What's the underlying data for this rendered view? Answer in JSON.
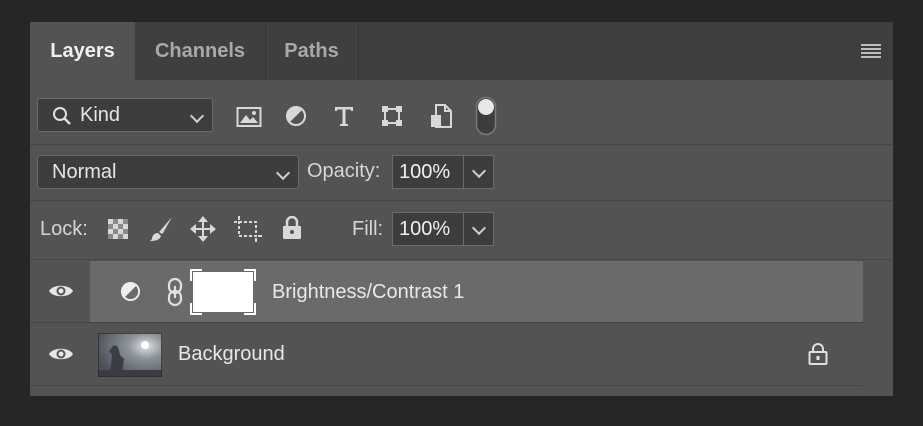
{
  "tabs": [
    {
      "label": "Layers",
      "active": true
    },
    {
      "label": "Channels",
      "active": false
    },
    {
      "label": "Paths",
      "active": false
    }
  ],
  "filter": {
    "kind_label": "Kind",
    "icons": [
      "image-filter-icon",
      "adjustment-filter-icon",
      "type-filter-icon",
      "shape-filter-icon",
      "smart-object-filter-icon",
      "filter-toggle-switch"
    ]
  },
  "blend": {
    "mode": "Normal",
    "opacity_label": "Opacity:",
    "opacity_value": "100%"
  },
  "lock": {
    "label": "Lock:",
    "fill_label": "Fill:",
    "fill_value": "100%"
  },
  "layers": [
    {
      "name": "Brightness/Contrast 1",
      "type": "adjustment",
      "visible": true,
      "selected": true
    },
    {
      "name": "Background",
      "type": "image",
      "visible": true,
      "locked": true
    }
  ],
  "colors": {
    "panel": "#535353",
    "tabbar": "#3f3f3f",
    "selected_row": "#6a6a6a",
    "background": "#262626"
  }
}
